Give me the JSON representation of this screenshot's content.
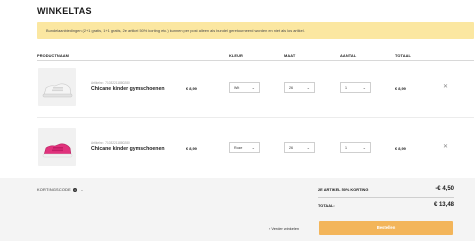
{
  "page": {
    "title": "WINKELTAS",
    "notice": "Bundelaanbiedingen (2+1 gratis, 1+1 gratis, 2e artikel 50% korting etc.) kunnen per post alleen als bundel geretourneerd worden en niet als los artikel."
  },
  "table": {
    "headers": {
      "product": "PRODUCTNAAM",
      "color": "KLEUR",
      "size": "MAAT",
      "quantity": "AANTAL",
      "total": "TOTAAL"
    }
  },
  "items": [
    {
      "sku": "Artikelnr.: 71032211880280",
      "name": "Chicane kinder gymschoenen",
      "price": "€ 8,99",
      "color": "Wit",
      "size": "26",
      "quantity": "1",
      "total": "€ 8,99",
      "shoe_color": "#f4f4f4",
      "sole_color": "#e2e2e2"
    },
    {
      "sku": "Artikelnr.: 71032211880280",
      "name": "Chicane kinder gymschoenen",
      "price": "€ 8,99",
      "color": "Roze",
      "size": "26",
      "quantity": "1",
      "total": "€ 8,99",
      "shoe_color": "#e0327c",
      "sole_color": "#f1f1f1"
    }
  ],
  "icons": {
    "remove": "close-icon",
    "dropdown": "chevron-down-icon",
    "info": "info-icon"
  },
  "footer": {
    "coupon_label": "KORTINGSCODE",
    "discount_label": "2E ARTIKEL 50% KORTING",
    "discount_value": "-€ 4,50",
    "total_label": "TOTAAL:",
    "total_value": "€ 13,48",
    "continue_label": "‹ Verder winkelen",
    "checkout_label": "Bestellen"
  },
  "colors": {
    "notice_bg": "#fbe7a1",
    "checkout_bg": "#f3b55a",
    "footer_bg": "#f4f4f4"
  }
}
